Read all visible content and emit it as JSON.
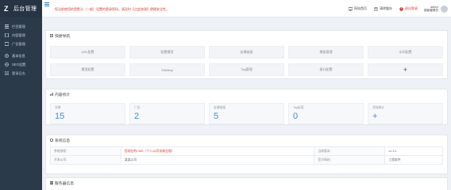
{
  "brand": {
    "logo_glyph": "Z",
    "title": "后台管理"
  },
  "sidebar": {
    "items": [
      {
        "label": "栏目管理"
      },
      {
        "label": "内容管理"
      },
      {
        "label": "广告管理"
      },
      {
        "label": "基本信息"
      },
      {
        "label": "SEO设置"
      },
      {
        "label": "登录日志"
      }
    ]
  },
  "topbar": {
    "notice": "您当前使用的是默认（一般）设置的登录密码，请及时【点此修改】便捷安全性。",
    "actions": [
      {
        "label": "网站首页"
      },
      {
        "label": "清除缓存"
      },
      {
        "label": "退出登录"
      }
    ],
    "user": {
      "name": "admin",
      "role": "超级管理员"
    }
  },
  "quick_nav": {
    "title": "快捷导航",
    "items": [
      "URL配置",
      "配置模型",
      "友情链接",
      "模板管理",
      "水印配置",
      "模型配置",
      "SiteMap",
      "Tag管理",
      "接口配置",
      "+"
    ]
  },
  "stats": {
    "title": "内容统计",
    "items": [
      {
        "label": "文章",
        "value": "15"
      },
      {
        "label": "广告",
        "value": "2"
      },
      {
        "label": "友情链接",
        "value": "5"
      },
      {
        "label": "Tag标签",
        "value": "0"
      },
      {
        "label": "添加统计",
        "value": "+"
      }
    ]
  },
  "sysinfo": {
    "title": "系统信息",
    "rows": [
      {
        "k1": "系统授权：",
        "v1": "您现在的CMS（个人/公司非商业版）",
        "k2": "当前版本：",
        "v2": "v1.3.1"
      },
      {
        "k1": "开发公司：",
        "v1": "某某公司",
        "k2": "官方网站：",
        "v2": "工程软件"
      }
    ]
  },
  "server": {
    "title": "服务器信息"
  },
  "colors": {
    "accent": "#3c8dd8",
    "danger": "#d9342b",
    "sidebar": "#2b3a4b"
  }
}
